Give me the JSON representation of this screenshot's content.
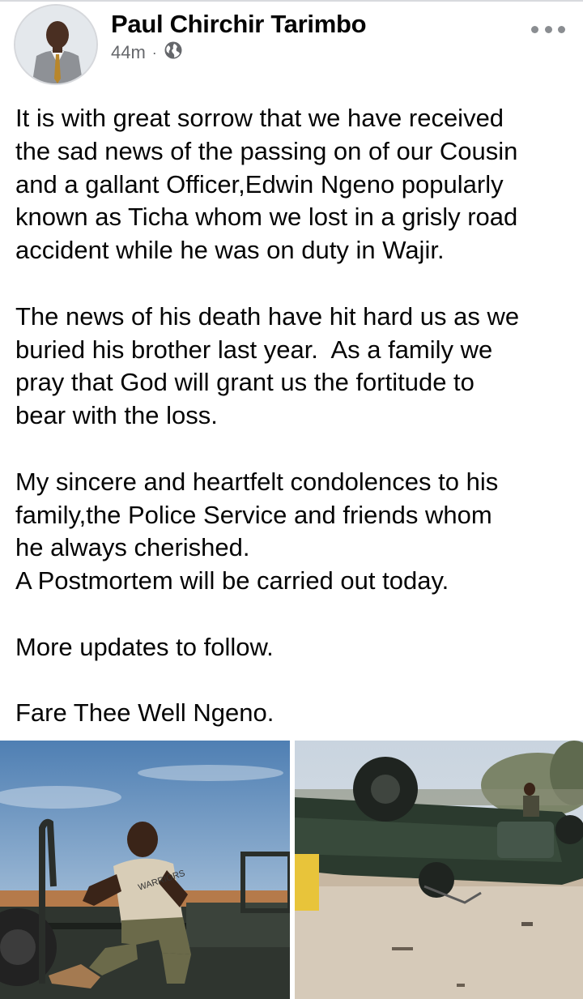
{
  "post": {
    "author": "Paul Chirchir Tarimbo",
    "time": "44m",
    "separator": "·",
    "privacy_icon": "globe-icon",
    "more_icon": "more-options-icon",
    "paragraphs": [
      "It is with great sorrow that we have received\nthe sad news of the passing on of our Cousin\nand a gallant Officer,Edwin Ngeno popularly\nknown as Ticha whom we lost in a grisly road\naccident while he was on duty in Wajir.",
      "The news of his death have hit hard us as we\nburied his brother last year.  As a family we\npray that God will grant us the fortitude to\nbear with the loss.",
      "My sincere and heartfelt condolences to his\nfamily,the Police Service and friends whom\nhe always cherished.\nA Postmortem will be carried out today.",
      "More updates to follow.",
      "Fare Thee Well Ngeno."
    ],
    "photo1_shirt_text": "WARRIORS"
  },
  "colors": {
    "text": "#050505",
    "meta": "#65676b",
    "divider": "#d8dade"
  }
}
